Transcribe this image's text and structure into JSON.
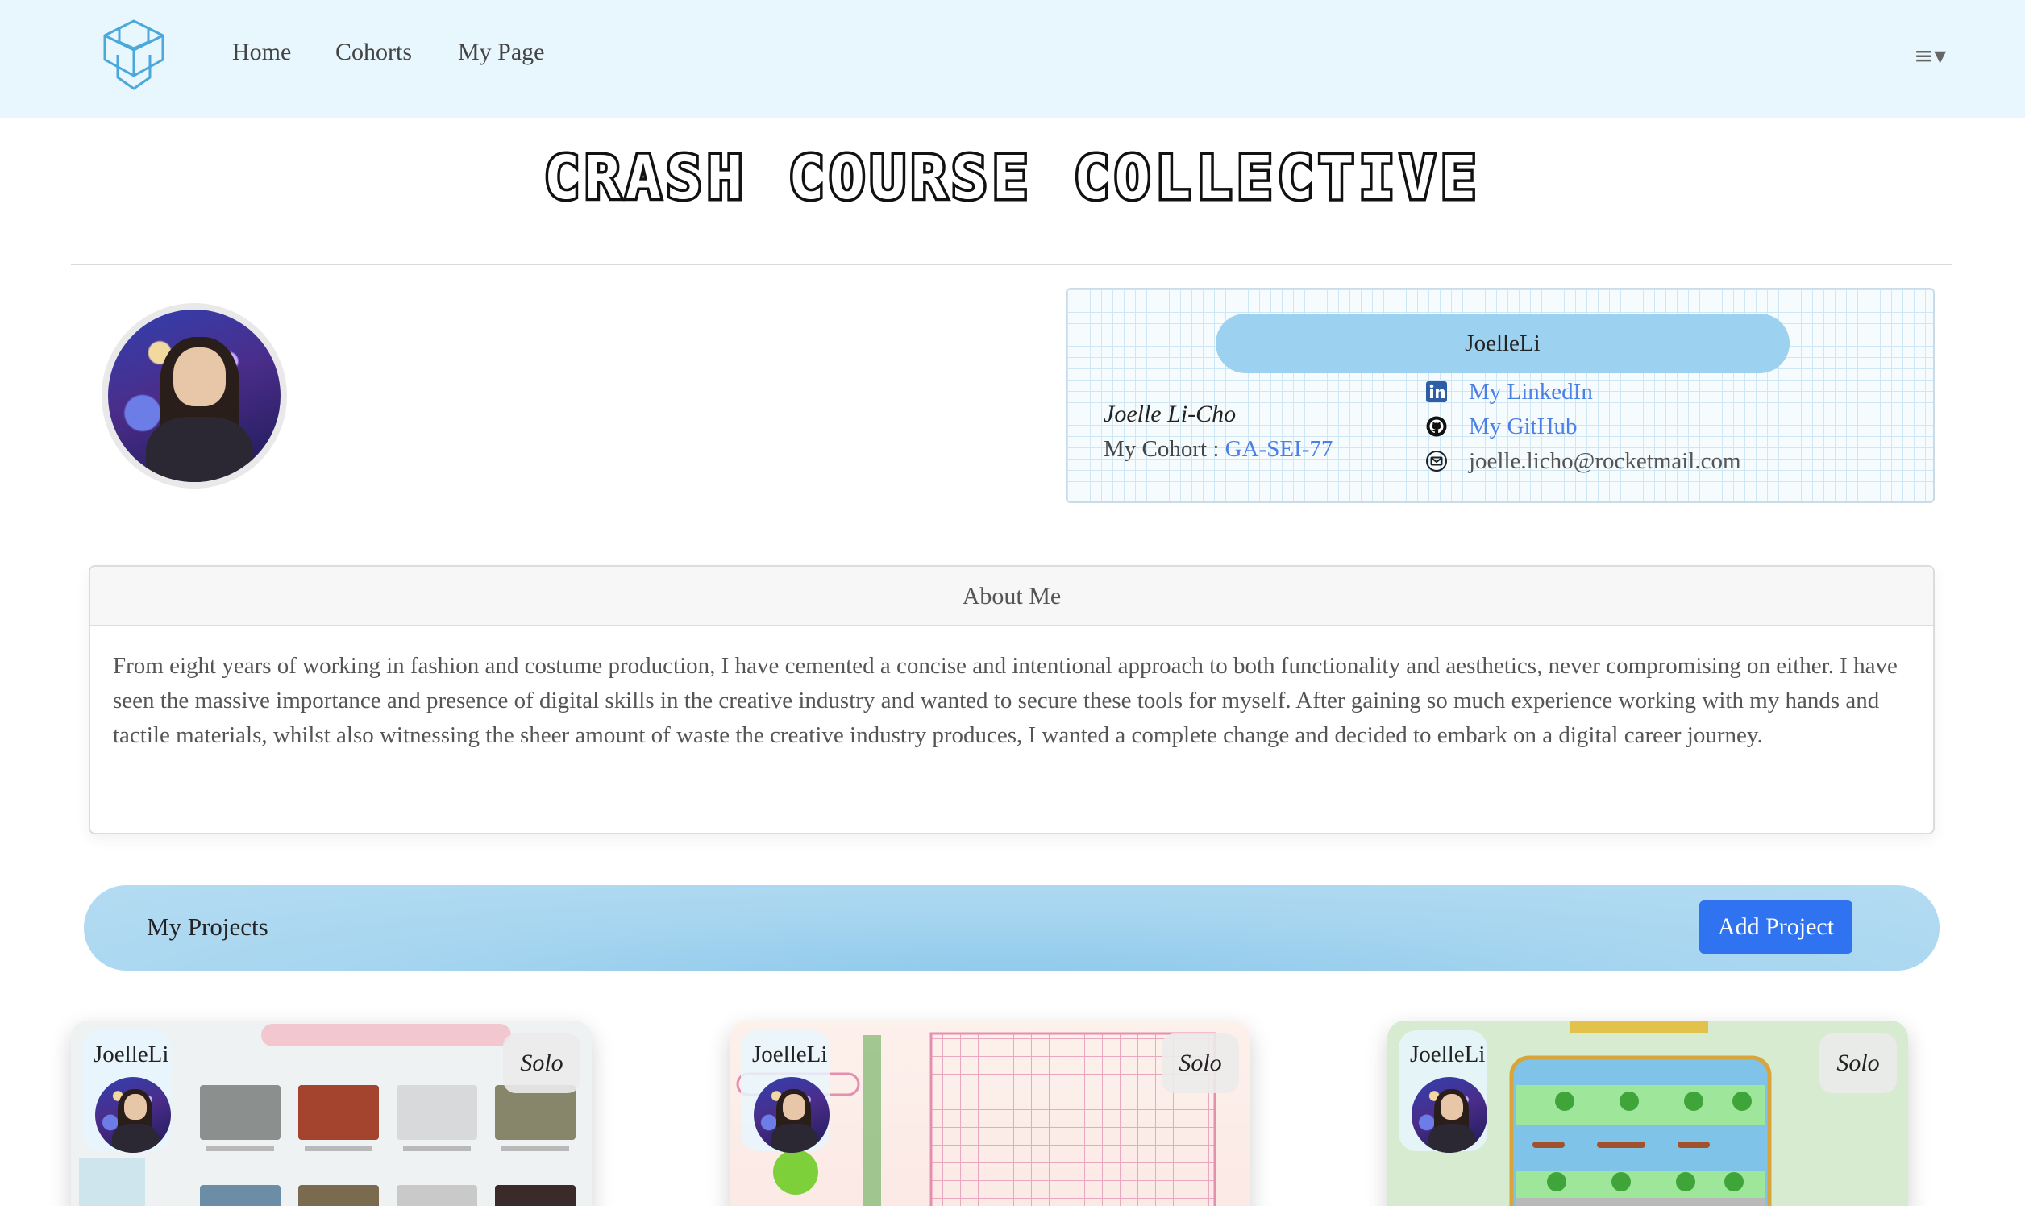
{
  "nav": {
    "home": "Home",
    "cohorts": "Cohorts",
    "my_page": "My Page",
    "menu_symbol": "≡▾"
  },
  "site_title": "CRASH COURSE COLLECTIVE",
  "profile": {
    "username": "JoelleLi",
    "full_name": "Joelle Li-Cho",
    "cohort_label": "My Cohort : ",
    "cohort_value": "GA-SEI-77",
    "linkedin_label": "My LinkedIn",
    "github_label": "My GitHub",
    "email": "joelle.licho@rocketmail.com"
  },
  "about": {
    "title": "About Me",
    "text": "From eight years of working in fashion and costume production, I have cemented a concise and intentional approach to both functionality and aesthetics, never compromising on either. I have seen the massive importance and presence of digital skills in the creative industry and wanted to secure these tools for myself. After gaining so much experience working with my hands and tactile materials, whilst also witnessing the sheer amount of waste the creative industry produces, I wanted a complete change and decided to embark on a digital career journey."
  },
  "projects": {
    "title": "My Projects",
    "add_button": "Add Project",
    "items": [
      {
        "username": "JoelleLi",
        "type": "Solo"
      },
      {
        "username": "JoelleLi",
        "type": "Solo"
      },
      {
        "username": "JoelleLi",
        "type": "Solo"
      }
    ]
  },
  "colors": {
    "navbar_bg": "#e8f6fd",
    "accent_blue": "#2f73f0",
    "link_blue": "#4a7fe6",
    "pill_blue": "#9cd1ef"
  },
  "icons": [
    "logo-icon",
    "menu-icon",
    "linkedin-icon",
    "github-icon",
    "mail-icon"
  ]
}
